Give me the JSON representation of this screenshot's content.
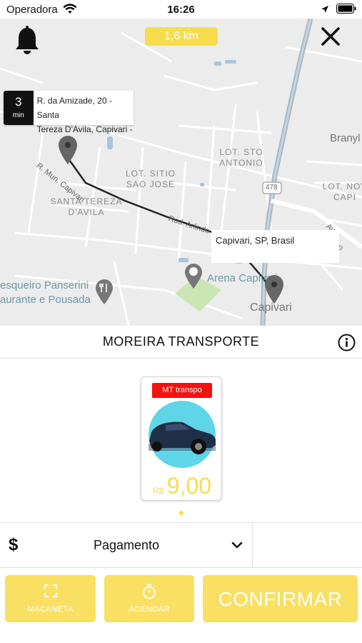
{
  "status_bar": {
    "carrier": "Operadora",
    "time": "16:26"
  },
  "map": {
    "distance": "1,6 km",
    "origin": {
      "time_value": "3",
      "time_unit": "min",
      "address_line1": "R. da Amizade, 20 - Santa",
      "address_line2": "Tereza D'Avila, Capivari -"
    },
    "destination": "Capivari, SP, Brasil",
    "labels": {
      "lot_sto_antonio_1": "LOT. STO",
      "lot_sto_antonio_2": "ANTONIO",
      "lot_sitio_1": "LOT. SITIO",
      "lot_sitio_2": "SAO JOSE",
      "santa_tereza_1": "SANTA TEREZA",
      "santa_tereza_2": "D'AVILA",
      "lot_novo_1": "LOT. NOV",
      "lot_novo_2": "CAPI",
      "branyl": "Branyl",
      "pesqueiro_1": "esqueiro Panserini",
      "pesqueiro_2": "aurante e Pousada",
      "arena": "Arena Capivari",
      "capivari": "Capivari",
      "route_478": "478",
      "road_mun": "R. Mun. Capivari",
      "road_rod": "Rod. Arlindo",
      "road_belmiro": "Av. Belmiro"
    }
  },
  "company": {
    "name": "MOREIRA TRANSPORTE"
  },
  "vehicle": {
    "tag": "MT transpo",
    "currency": "R$",
    "price": "9,00"
  },
  "payment": {
    "label": "Pagamento",
    "currency_symbol": "$"
  },
  "buttons": {
    "macaneta": "MAÇANETA",
    "agendar": "AGENDAR",
    "confirmar": "CONFIRMAR"
  },
  "colors": {
    "accent_yellow": "#f7dc4e",
    "button_yellow": "#f9df62",
    "tag_red": "#f3120e",
    "map_bg": "#ececec"
  }
}
